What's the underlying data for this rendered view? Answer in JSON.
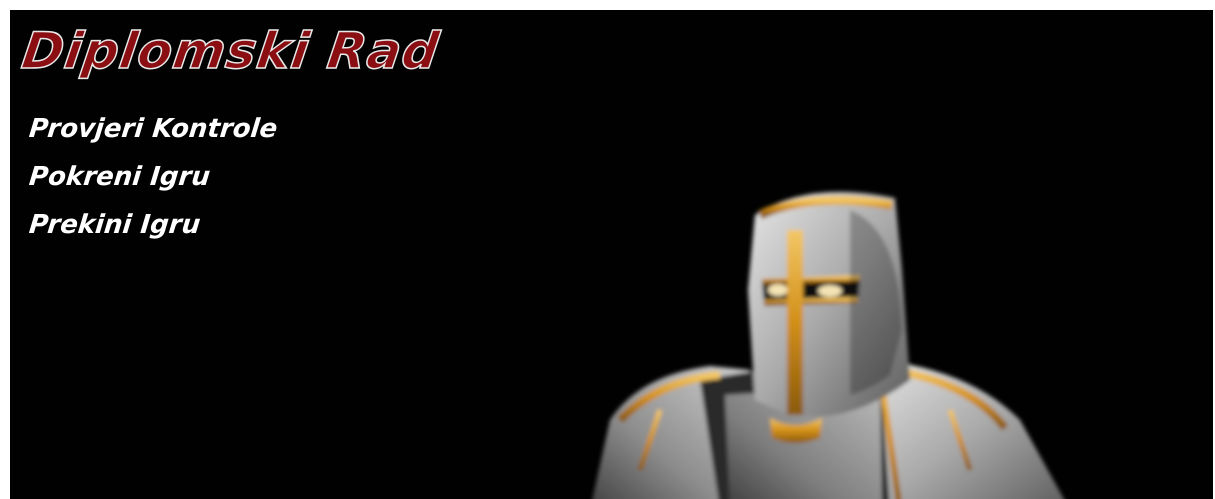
{
  "title": "Diplomski Rad",
  "menu": {
    "items": [
      {
        "label": "Provjeri Kontrole"
      },
      {
        "label": "Pokreni Igru"
      },
      {
        "label": "Prekini Igru"
      }
    ]
  },
  "colors": {
    "background": "#010101",
    "title_fill": "#8b0f12",
    "title_outline": "#e9e9e9",
    "menu_text": "#ffffff",
    "armor_silver": "#b9b9b9",
    "armor_gold": "#d79a1e"
  }
}
